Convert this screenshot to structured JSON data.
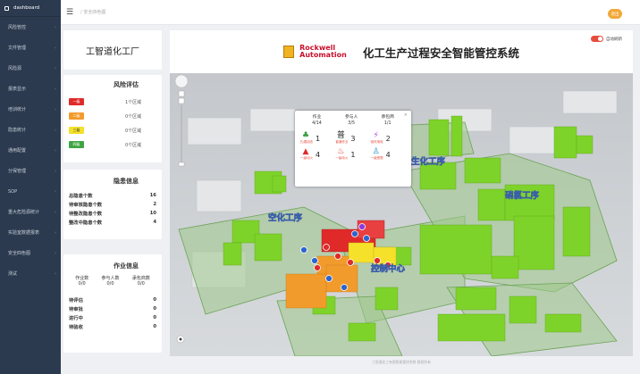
{
  "sidebar": {
    "brand": "dashboard",
    "items": [
      {
        "label": "风险管控"
      },
      {
        "label": "文件管理"
      },
      {
        "label": "风险源"
      },
      {
        "label": "报表显示"
      },
      {
        "label": "培训统计"
      },
      {
        "label": "隐患统计"
      },
      {
        "label": "通用配置"
      },
      {
        "label": "分保管理"
      },
      {
        "label": "SOP"
      },
      {
        "label": "重大危险源统计"
      },
      {
        "label": "实验室数据报表"
      },
      {
        "label": "安全四色图"
      },
      {
        "label": "测试"
      }
    ]
  },
  "topbar": {
    "breadcrumb": "/ 安全四色图",
    "exit_label": "退出"
  },
  "factory": {
    "name": "工智道化工厂"
  },
  "risk": {
    "title": "风险评估",
    "levels": [
      {
        "chip": "一级",
        "text": "1个区域",
        "color": "#e02a2a"
      },
      {
        "chip": "二级",
        "text": "0个区域",
        "color": "#f29b2d"
      },
      {
        "chip": "三级",
        "text": "0个区域",
        "color": "#f4e02a"
      },
      {
        "chip": "四级",
        "text": "0个区域",
        "color": "#3fa444"
      }
    ]
  },
  "hazard": {
    "title": "隐患信息",
    "rows": [
      {
        "label": "总隐患个数",
        "value": "16"
      },
      {
        "label": "待审核隐患个数",
        "value": "2"
      },
      {
        "label": "待整改隐患个数",
        "value": "10"
      },
      {
        "label": "整改中隐患个数",
        "value": "4"
      }
    ]
  },
  "job": {
    "title": "作业信息",
    "heads": [
      {
        "label": "作业数",
        "value": "0/0"
      },
      {
        "label": "参与人数",
        "value": "0/0"
      },
      {
        "label": "承包商数",
        "value": "0/0"
      }
    ],
    "rows": [
      {
        "label": "待评估",
        "value": "0"
      },
      {
        "label": "待审批",
        "value": "0"
      },
      {
        "label": "进行中",
        "value": "0"
      },
      {
        "label": "待验收",
        "value": "0"
      }
    ]
  },
  "header": {
    "logo_line1": "Rockwell",
    "logo_line2": "Automation",
    "title": "化工生产过程安全智能管控系统",
    "toggle_label": "自动刷新"
  },
  "popup": {
    "cols": [
      {
        "label": "作业",
        "value": "4/14"
      },
      {
        "label": "参与人",
        "value": "3/5"
      },
      {
        "label": "承包商",
        "value": "1/1"
      }
    ],
    "cells": [
      {
        "icon": "person-icon",
        "label": "扎帽动态",
        "num": "1",
        "color": "#2e9a3d"
      },
      {
        "icon": "general-icon",
        "label": "普通作业",
        "num": "3",
        "color": "#222"
      },
      {
        "icon": "lightning-icon",
        "label": "临时用电",
        "num": "2",
        "color": "#a341e0"
      },
      {
        "icon": "fire-hazard-icon",
        "label": "一级动火",
        "num": "4",
        "color": "#e02a2a"
      },
      {
        "icon": "flame-icon",
        "label": "一级动火",
        "num": "1",
        "color": "#e02a2a"
      },
      {
        "icon": "worker-icon",
        "label": "一级受限",
        "num": "4",
        "color": "#2a8fd0"
      }
    ]
  },
  "map_labels": [
    "生化工序",
    "硝氯工序",
    "空化工序",
    "控制中心"
  ],
  "footer": "工智道化工有限智能管控系统 版权所有"
}
